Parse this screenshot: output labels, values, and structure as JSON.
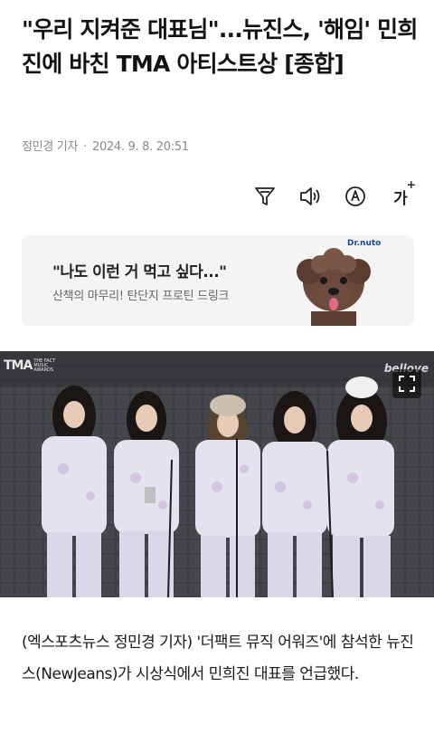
{
  "article": {
    "headline": "\"우리 지켜준 대표님\"...뉴진스, '해임' 민희진에 바친 TMA 아티스트상 [종합]",
    "reporter": "정민경 기자",
    "timestamp": "2024. 9. 8. 20:51",
    "body": "(엑스포츠뉴스 정민경 기자) '더팩트 뮤직 어워즈'에 참석한 뉴진스(NewJeans)가 시상식에서 민희진 대표를 언급했다."
  },
  "toolbar": {
    "items": [
      "summary-icon",
      "speaker-icon",
      "translate-icon",
      "font-size-icon"
    ],
    "font_size_label": "가"
  },
  "ad": {
    "title": "\"나도 이런 거 먹고 싶다...\"",
    "subtitle": "산책의 마무리! 탄단지 프로틴 드링크",
    "brand": "Dr.nuto"
  },
  "photo": {
    "logo": "TMA",
    "logo_small": "THE FACT MUSIC AWARDS",
    "watermark": "bellove"
  }
}
